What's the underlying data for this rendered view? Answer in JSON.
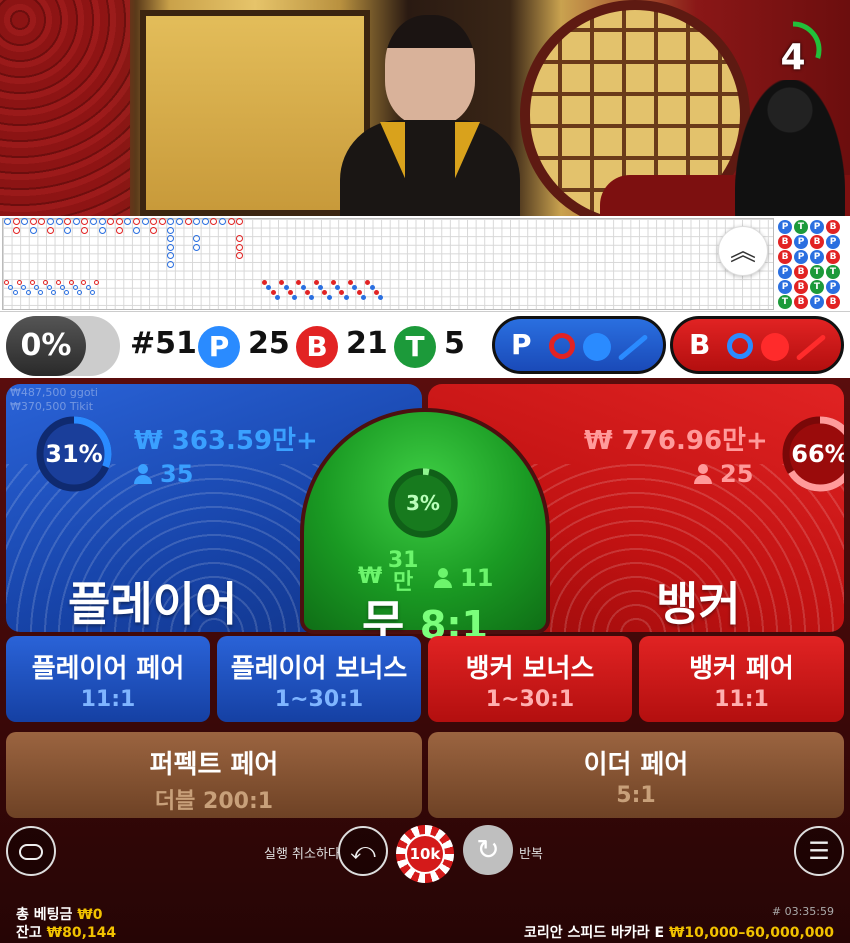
{
  "timer": {
    "seconds": "4",
    "fraction": 0.3
  },
  "stats": {
    "percent_toggle": "0%",
    "round": "#51",
    "player": {
      "letter": "P",
      "count": "25"
    },
    "banker": {
      "letter": "B",
      "count": "21"
    },
    "tie": {
      "letter": "T",
      "count": "5"
    },
    "predict_player": "P",
    "predict_banker": "B"
  },
  "main_bets": {
    "player": {
      "label": "플레이어",
      "amount": "₩ 363.59만+",
      "players": "35",
      "percent": "31%",
      "percent_value": 31,
      "ghost_text_1": "₩487,500  ggoti",
      "ghost_text_2": "₩370,500  Tikit"
    },
    "tie": {
      "label": "무",
      "odds": "8:1",
      "amount_prefix": "₩",
      "amount_value": "31",
      "amount_unit": "만",
      "players": "11",
      "percent": "3%",
      "percent_value": 3
    },
    "banker": {
      "label": "뱅커",
      "amount": "₩ 776.96만+",
      "players": "25",
      "percent": "66%",
      "percent_value": 66
    }
  },
  "side_bets": [
    {
      "label": "플레이어 페어",
      "odds": "11:1",
      "color": "blue"
    },
    {
      "label": "플레이어 보너스",
      "odds": "1~30:1",
      "color": "blue"
    },
    {
      "label": "뱅커 보너스",
      "odds": "1~30:1",
      "color": "red"
    },
    {
      "label": "뱅커 페어",
      "odds": "11:1",
      "color": "red"
    }
  ],
  "special_bets": [
    {
      "label": "퍼펙트 페어",
      "odds": "더블 200:1"
    },
    {
      "label": "이더 페어",
      "odds": "5:1"
    }
  ],
  "controls": {
    "undo_label": "실행 취소하다",
    "chip_value": "10k",
    "repeat_label": "반복"
  },
  "footer": {
    "total_bet_label": "총 베팅금",
    "total_bet_value": "₩0",
    "balance_label": "잔고",
    "balance_value": "₩80,144",
    "round_id": "# 03:35:59",
    "table_name": "코리안 스피드 바카라 E",
    "limits": "₩10,000–60,000,000"
  },
  "colors": {
    "player": "#2a6fe0",
    "banker": "#e22323",
    "tie": "#1c9a3a",
    "accent": "#f2c200"
  },
  "icons": [
    "chevrons-up-icon",
    "person-icon",
    "chat-icon",
    "undo-icon",
    "repeat-icon",
    "menu-icon"
  ]
}
